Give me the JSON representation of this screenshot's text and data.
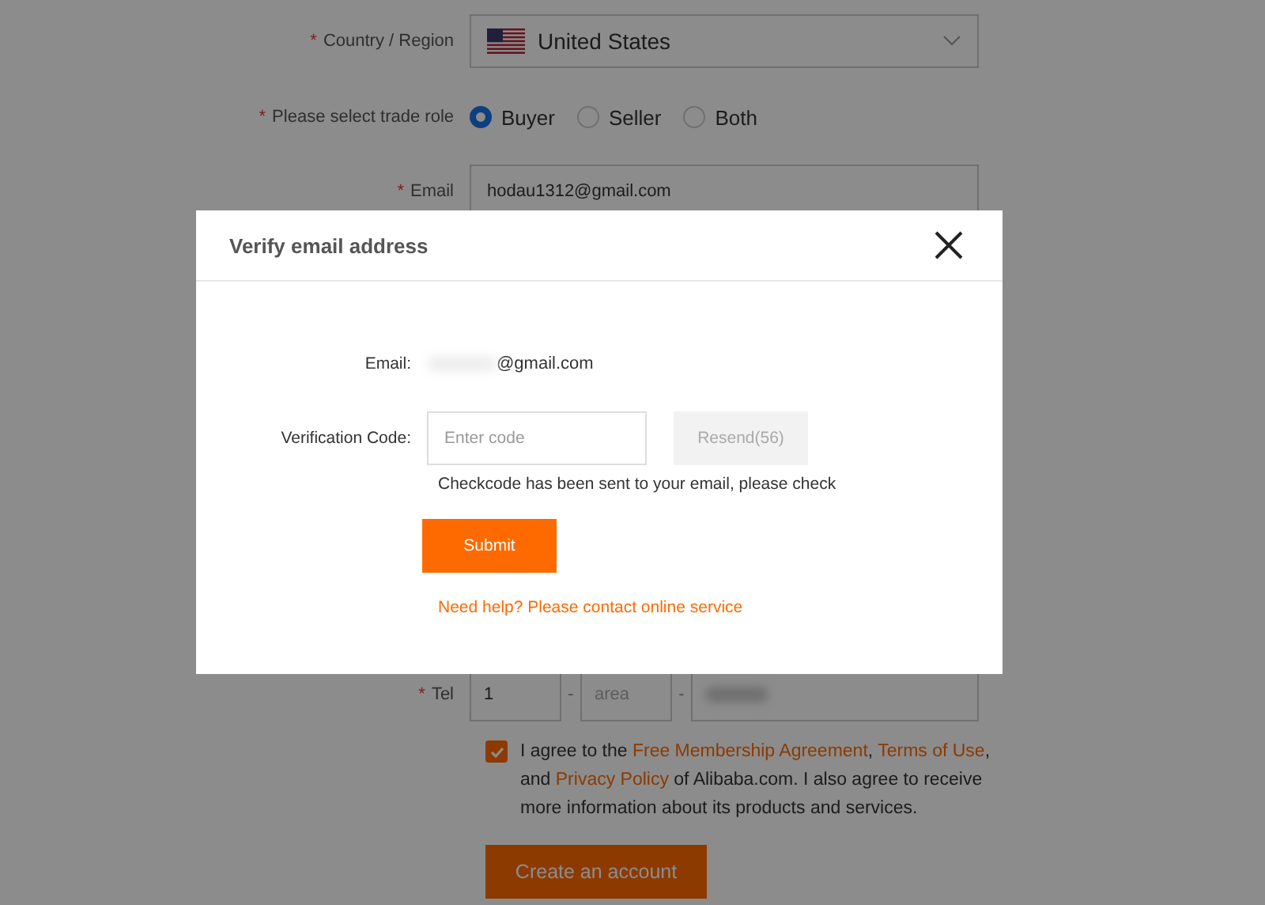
{
  "form": {
    "country": {
      "label": "Country / Region",
      "required_mark": "*",
      "value": "United States"
    },
    "trade_role": {
      "label": "Please select trade role",
      "required_mark": "*",
      "options": [
        {
          "label": "Buyer",
          "selected": true
        },
        {
          "label": "Seller",
          "selected": false
        },
        {
          "label": "Both",
          "selected": false
        }
      ]
    },
    "email": {
      "label": "Email",
      "required_mark": "*",
      "value": "hodau1312@gmail.com"
    },
    "tel": {
      "label": "Tel",
      "required_mark": "*",
      "country_code": "1",
      "area_placeholder": "area",
      "separators": [
        "-",
        "-"
      ]
    },
    "agreement": {
      "checked": true,
      "segments": [
        {
          "text": "I agree to the ",
          "link": false
        },
        {
          "text": "Free Membership Agreement",
          "link": true
        },
        {
          "text": ", ",
          "link": false
        },
        {
          "text": "Terms of Use",
          "link": true
        },
        {
          "text": ", and ",
          "link": false
        },
        {
          "text": "Privacy Policy",
          "link": true
        },
        {
          "text": " of Alibaba.com. I also agree to receive more information about its products and services.",
          "link": false
        }
      ]
    },
    "create_button": "Create an account"
  },
  "dialog": {
    "title": "Verify email address",
    "email_label": "Email:",
    "email_value": "@gmail.com",
    "code_label": "Verification Code:",
    "code_placeholder": "Enter code",
    "resend_button": "Resend(56)",
    "resend_disabled": true,
    "hint": "Checkcode has been sent to your email, please check",
    "submit_button": "Submit",
    "help_link": "Need help? Please contact online service"
  }
}
